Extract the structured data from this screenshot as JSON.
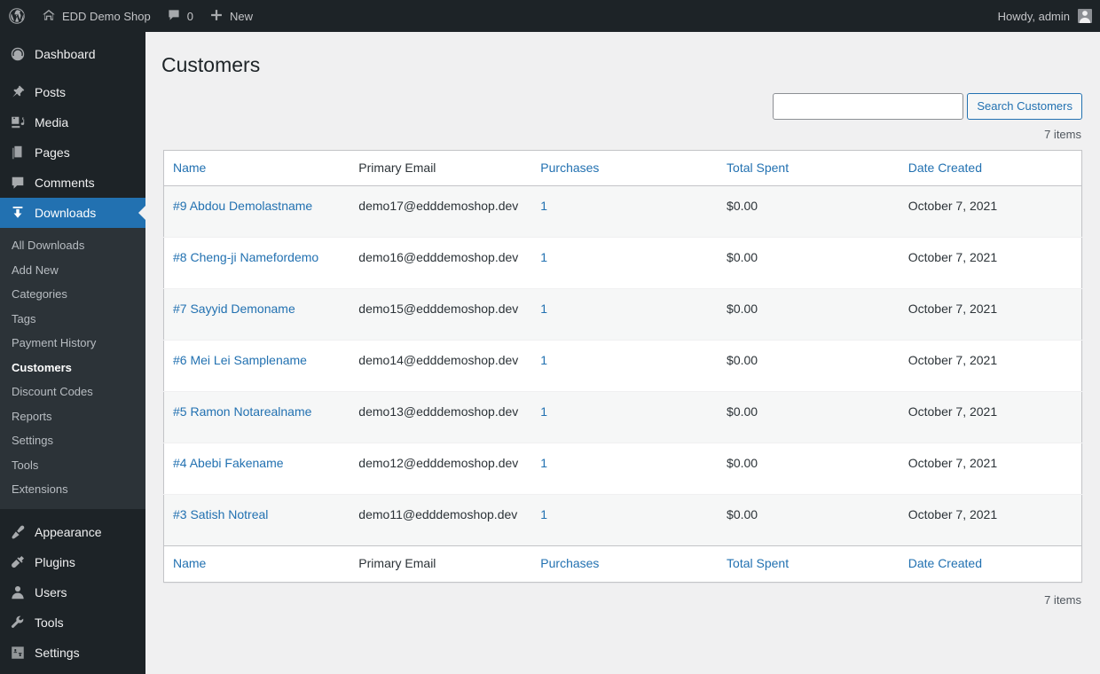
{
  "adminbar": {
    "wp_logo_icon": "wordpress-logo-icon",
    "site_home_icon": "home-icon",
    "site_name": "EDD Demo Shop",
    "comments_icon": "comment-bubble-icon",
    "comments_count": "0",
    "new_icon": "plus-icon",
    "new_label": "New",
    "howdy": "Howdy, admin",
    "avatar_icon": "user-avatar-icon"
  },
  "sidebar": {
    "top_items": [
      {
        "label": "Dashboard",
        "icon": "dashboard-gauge-icon",
        "current": false
      },
      {
        "label": "Posts",
        "icon": "pushpin-icon",
        "current": false
      },
      {
        "label": "Media",
        "icon": "media-photo-music-icon",
        "current": false
      },
      {
        "label": "Pages",
        "icon": "pages-document-icon",
        "current": false
      },
      {
        "label": "Comments",
        "icon": "comment-bubble-icon",
        "current": false
      },
      {
        "label": "Downloads",
        "icon": "download-arrow-icon",
        "current": true
      }
    ],
    "submenu": [
      {
        "label": "All Downloads",
        "current": false
      },
      {
        "label": "Add New",
        "current": false
      },
      {
        "label": "Categories",
        "current": false
      },
      {
        "label": "Tags",
        "current": false
      },
      {
        "label": "Payment History",
        "current": false
      },
      {
        "label": "Customers",
        "current": true
      },
      {
        "label": "Discount Codes",
        "current": false
      },
      {
        "label": "Reports",
        "current": false
      },
      {
        "label": "Settings",
        "current": false
      },
      {
        "label": "Tools",
        "current": false
      },
      {
        "label": "Extensions",
        "current": false
      }
    ],
    "bottom_items": [
      {
        "label": "Appearance",
        "icon": "paintbrush-icon",
        "current": false
      },
      {
        "label": "Plugins",
        "icon": "plug-icon",
        "current": false
      },
      {
        "label": "Users",
        "icon": "user-icon",
        "current": false
      },
      {
        "label": "Tools",
        "icon": "wrench-icon",
        "current": false
      },
      {
        "label": "Settings",
        "icon": "sliders-icon",
        "current": false
      }
    ]
  },
  "page": {
    "title": "Customers",
    "search_value": "",
    "search_placeholder": "",
    "search_button": "Search Customers",
    "items_count_top": "7 items",
    "items_count_bottom": "7 items"
  },
  "table": {
    "columns": [
      {
        "label": "Name",
        "sortable": true
      },
      {
        "label": "Primary Email",
        "sortable": false
      },
      {
        "label": "Purchases",
        "sortable": true
      },
      {
        "label": "Total Spent",
        "sortable": true
      },
      {
        "label": "Date Created",
        "sortable": true
      }
    ],
    "rows": [
      {
        "name": "#9 Abdou Demolastname",
        "email": "demo17@edddemoshop.dev",
        "purchases": "1",
        "spent": "$0.00",
        "date": "October 7, 2021"
      },
      {
        "name": "#8 Cheng-ji Namefordemo",
        "email": "demo16@edddemoshop.dev",
        "purchases": "1",
        "spent": "$0.00",
        "date": "October 7, 2021"
      },
      {
        "name": "#7 Sayyid Demoname",
        "email": "demo15@edddemoshop.dev",
        "purchases": "1",
        "spent": "$0.00",
        "date": "October 7, 2021"
      },
      {
        "name": "#6 Mei Lei Samplename",
        "email": "demo14@edddemoshop.dev",
        "purchases": "1",
        "spent": "$0.00",
        "date": "October 7, 2021"
      },
      {
        "name": "#5 Ramon Notarealname",
        "email": "demo13@edddemoshop.dev",
        "purchases": "1",
        "spent": "$0.00",
        "date": "October 7, 2021"
      },
      {
        "name": "#4 Abebi Fakename",
        "email": "demo12@edddemoshop.dev",
        "purchases": "1",
        "spent": "$0.00",
        "date": "October 7, 2021"
      },
      {
        "name": "#3 Satish Notreal",
        "email": "demo11@edddemoshop.dev",
        "purchases": "1",
        "spent": "$0.00",
        "date": "October 7, 2021"
      }
    ]
  },
  "colors": {
    "admin_dark": "#1d2327",
    "submenu_dark": "#2c3338",
    "accent_blue": "#2271b1",
    "link_blue": "#2271b1",
    "page_bg": "#f0f0f1",
    "row_alt": "#f6f7f7"
  }
}
